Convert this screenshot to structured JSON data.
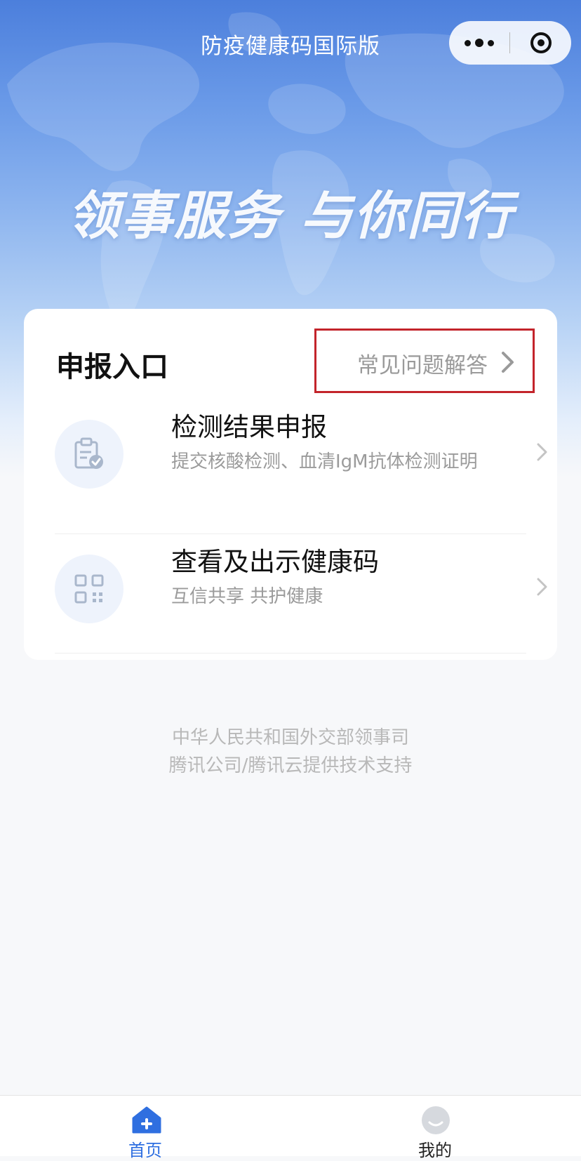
{
  "header": {
    "title": "防疫健康码国际版",
    "more_icon": "more-dots-icon",
    "close_icon": "capsule-close-icon"
  },
  "banner": {
    "slogan": "领事服务 与你同行"
  },
  "declaration": {
    "title": "申报入口",
    "faq_label": "常见问题解答",
    "items": [
      {
        "title": "检测结果申报",
        "subtitle": "提交核酸检测、血清IgM抗体检测证明",
        "icon": "clipboard-check-icon"
      },
      {
        "title": "查看及出示健康码",
        "subtitle": "互信共享 共护健康",
        "icon": "qr-code-icon"
      }
    ]
  },
  "footer": {
    "line1": "中华人民共和国外交部领事司",
    "line2": "腾讯公司/腾讯云提供技术支持"
  },
  "tabbar": {
    "items": [
      {
        "label": "首页",
        "icon": "home-icon",
        "active": true
      },
      {
        "label": "我的",
        "icon": "user-icon",
        "active": false
      }
    ]
  },
  "colors": {
    "accent": "#2f6fe0",
    "highlight_border": "#c3242b",
    "hero_top": "#4c7fdc"
  }
}
